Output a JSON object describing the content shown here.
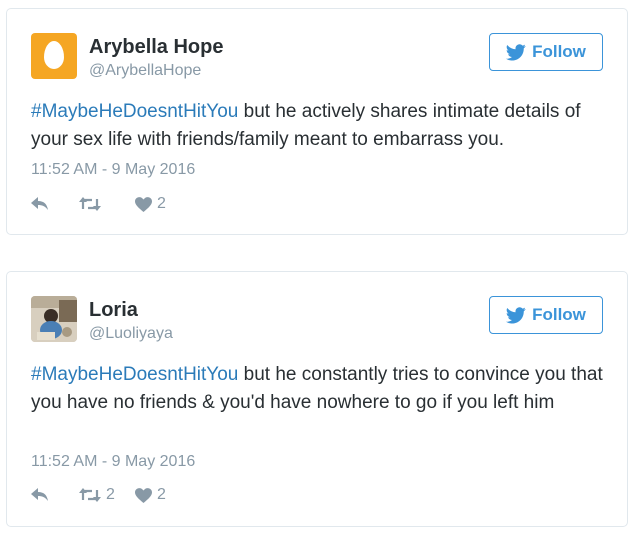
{
  "tweets": [
    {
      "name": "Arybella Hope",
      "handle": "@ArybellaHope",
      "avatar": "egg-avatar",
      "follow_label": "Follow",
      "hashtag": "#MaybeHeDoesntHitYou",
      "text": " but he actively shares intimate details of your sex life with friends/family meant to embarrass you.",
      "timestamp": "11:52 AM - 9 May 2016",
      "retweets": "",
      "likes": "2"
    },
    {
      "name": "Loria",
      "handle": "@Luoliyaya",
      "avatar": "photo-avatar",
      "follow_label": "Follow",
      "hashtag": "#MaybeHeDoesntHitYou",
      "text": " but he constantly tries to convince you that you have no friends & you'd have nowhere to go if you left him",
      "timestamp": "11:52 AM - 9 May 2016",
      "retweets": "2",
      "likes": "2"
    }
  ],
  "icons": {
    "follow": "twitter-bird-icon",
    "reply": "reply-arrow-icon",
    "retweet": "retweet-icon",
    "like": "heart-icon"
  },
  "colors": {
    "brand_blue": "#3b94d9",
    "hashtag": "#2b7bb9",
    "muted": "#8899a6",
    "text": "#292f33",
    "border": "#e1e8ed",
    "egg_avatar": "#f5a623"
  }
}
